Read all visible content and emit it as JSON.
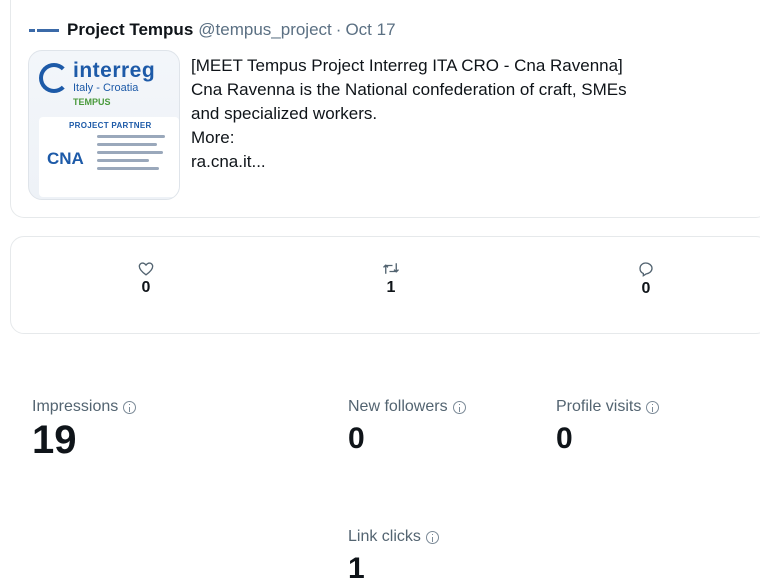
{
  "tweet": {
    "author_name": "Project Tempus",
    "author_handle": "@tempus_project",
    "separator": "·",
    "date": "Oct 17",
    "lines": [
      "[MEET Tempus Project Interreg ITA CRO - Cna Ravenna]",
      "Cna Ravenna is the National confederation of craft, SMEs",
      "and specialized workers.",
      "More:",
      "ra.cna.it..."
    ],
    "media": {
      "logo_word": "interreg",
      "logo_sub": "Italy - Croatia",
      "band": "TEMPUS",
      "partner_label": "PROJECT PARTNER",
      "partner_logo": "CNA"
    }
  },
  "engagement": {
    "likes": "0",
    "retweets": "1",
    "replies": "0",
    "icons": {
      "likes": "heart-icon",
      "retweets": "retweet-icon",
      "replies": "reply-icon"
    }
  },
  "metrics": {
    "impressions": {
      "label": "Impressions",
      "value": "19"
    },
    "new_followers": {
      "label": "New followers",
      "value": "0"
    },
    "profile_visits": {
      "label": "Profile visits",
      "value": "0"
    },
    "link_clicks": {
      "label": "Link clicks",
      "value": "1"
    }
  },
  "colors": {
    "text": "#0f1419",
    "muted": "#5b7083",
    "border": "#e6e9eb",
    "brand_blue": "#1d5aa8"
  }
}
